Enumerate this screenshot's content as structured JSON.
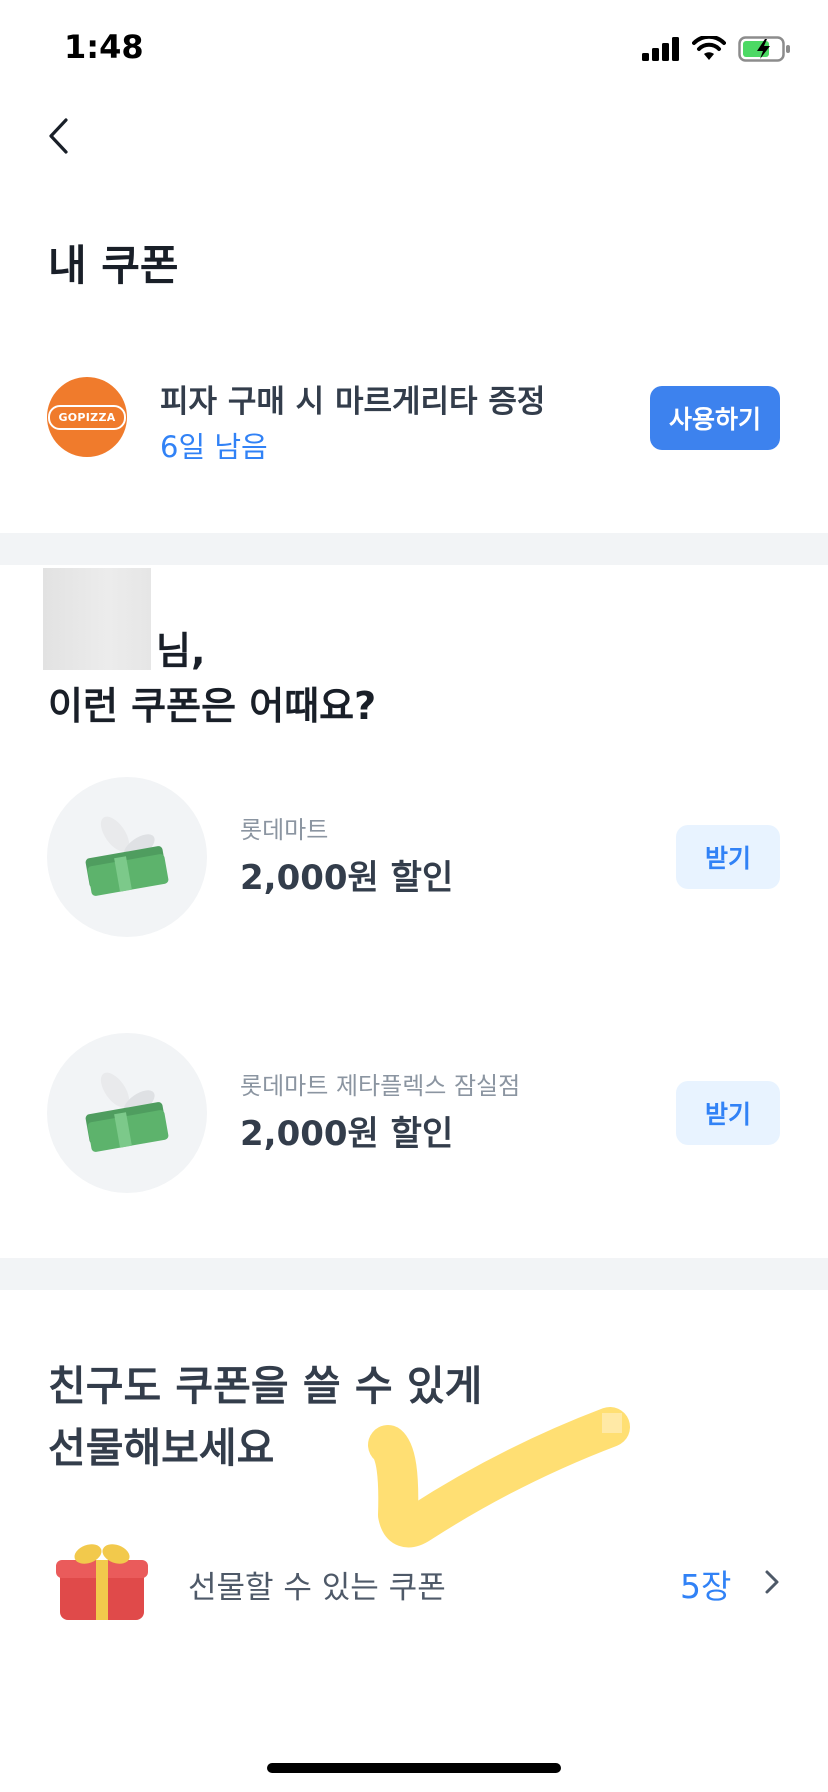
{
  "status_bar": {
    "time": "1:48"
  },
  "header": {
    "title": "내 쿠폰"
  },
  "my_coupon": {
    "logo_text": "GOPIZZA",
    "title": "피자 구매 시 마르게리타 증정",
    "remaining": "6일 남음",
    "use_label": "사용하기"
  },
  "recommend": {
    "greeting_suffix": "님,",
    "title": "이런 쿠폰은 어때요?",
    "items": [
      {
        "store": "롯데마트",
        "discount": "2,000원 할인",
        "button": "받기"
      },
      {
        "store": "롯데마트 제타플렉스 잠실점",
        "discount": "2,000원 할인",
        "button": "받기"
      }
    ]
  },
  "gift": {
    "title_line1": "친구도 쿠폰을 쓸 수 있게",
    "title_line2": "선물해보세요",
    "row_label": "선물할 수 있는 쿠폰",
    "count": "5장"
  },
  "colors": {
    "accent": "#3182f6",
    "brand_orange": "#f07b2c",
    "divider": "#f2f4f6",
    "highlighter": "#ffd95a"
  }
}
